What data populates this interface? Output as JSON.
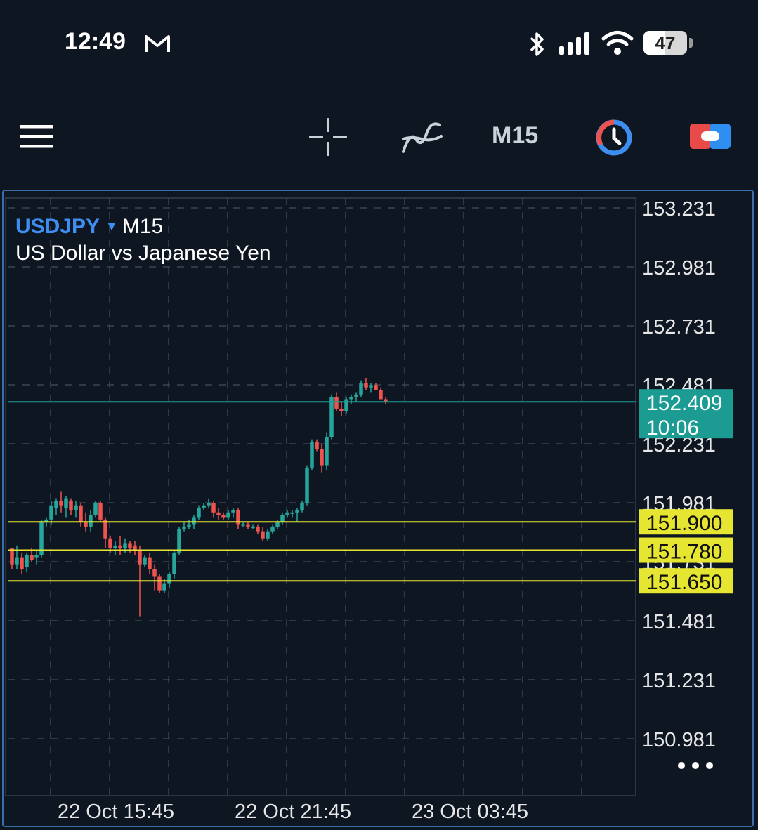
{
  "status_bar": {
    "time": "12:49",
    "battery": "47"
  },
  "toolbar": {
    "timeframe": "M15"
  },
  "chart": {
    "symbol": "USDJPY",
    "timeframe": "M15",
    "description": "US Dollar vs Japanese Yen",
    "current_price": "152.409",
    "countdown": "10:06"
  },
  "colors": {
    "background": "#0e1621",
    "bull": "#26a69a",
    "bear": "#ef5350",
    "level_line": "#e6e632",
    "current_line": "#1c9b93",
    "accent": "#3d8ef0"
  },
  "chart_data": {
    "type": "candlestick",
    "y_ticks": [
      "153.231",
      "152.981",
      "152.731",
      "152.481",
      "152.231",
      "151.981",
      "151.731",
      "151.481",
      "151.231",
      "150.981"
    ],
    "x_labels": [
      "22 Oct 15:45",
      "22 Oct 21:45",
      "23 Oct 03:45"
    ],
    "horizontal_levels": [
      {
        "value": 151.9,
        "label": "151.900"
      },
      {
        "value": 151.78,
        "label": "151.780"
      },
      {
        "value": 151.65,
        "label": "151.650"
      }
    ],
    "current_price": 152.409,
    "candles": [
      [
        151.79,
        151.79,
        151.7,
        151.72
      ],
      [
        151.72,
        151.8,
        151.7,
        151.75
      ],
      [
        151.75,
        151.77,
        151.68,
        151.7
      ],
      [
        151.71,
        151.77,
        151.69,
        151.76
      ],
      [
        151.76,
        151.79,
        151.73,
        151.74
      ],
      [
        151.75,
        151.78,
        151.72,
        151.76
      ],
      [
        151.76,
        151.91,
        151.75,
        151.9
      ],
      [
        151.9,
        151.92,
        151.88,
        151.91
      ],
      [
        151.91,
        151.99,
        151.89,
        151.97
      ],
      [
        151.96,
        152.0,
        151.93,
        151.99
      ],
      [
        151.99,
        152.03,
        151.94,
        151.97
      ],
      [
        151.96,
        152.01,
        151.92,
        152.0
      ],
      [
        151.99,
        152.0,
        151.93,
        151.95
      ],
      [
        151.95,
        151.99,
        151.92,
        151.97
      ],
      [
        151.97,
        151.98,
        151.88,
        151.9
      ],
      [
        151.9,
        151.94,
        151.86,
        151.88
      ],
      [
        151.88,
        151.95,
        151.86,
        151.93
      ],
      [
        151.93,
        151.99,
        151.92,
        151.98
      ],
      [
        151.98,
        151.99,
        151.9,
        151.91
      ],
      [
        151.91,
        151.92,
        151.79,
        151.83
      ],
      [
        151.83,
        151.84,
        151.77,
        151.79
      ],
      [
        151.79,
        151.82,
        151.76,
        151.8
      ],
      [
        151.8,
        151.84,
        151.76,
        151.79
      ],
      [
        151.79,
        151.83,
        151.77,
        151.81
      ],
      [
        151.81,
        151.82,
        151.77,
        151.79
      ],
      [
        151.8,
        151.82,
        151.76,
        151.78
      ],
      [
        151.78,
        151.8,
        151.5,
        151.72
      ],
      [
        151.72,
        151.76,
        151.71,
        151.75
      ],
      [
        151.75,
        151.77,
        151.68,
        151.7
      ],
      [
        151.7,
        151.72,
        151.61,
        151.67
      ],
      [
        151.67,
        151.68,
        151.6,
        151.61
      ],
      [
        151.61,
        151.66,
        151.6,
        151.64
      ],
      [
        151.64,
        151.69,
        151.62,
        151.68
      ],
      [
        151.68,
        151.78,
        151.66,
        151.77
      ],
      [
        151.77,
        151.88,
        151.76,
        151.87
      ],
      [
        151.87,
        151.9,
        151.86,
        151.88
      ],
      [
        151.88,
        151.91,
        151.87,
        151.89
      ],
      [
        151.89,
        151.93,
        151.87,
        151.92
      ],
      [
        151.92,
        151.97,
        151.91,
        151.96
      ],
      [
        151.96,
        151.98,
        151.95,
        151.97
      ],
      [
        151.97,
        152.0,
        151.96,
        151.98
      ],
      [
        151.98,
        151.99,
        151.92,
        151.94
      ],
      [
        151.94,
        151.96,
        151.91,
        151.93
      ],
      [
        151.93,
        151.94,
        151.91,
        151.92
      ],
      [
        151.92,
        151.95,
        151.91,
        151.94
      ],
      [
        151.94,
        151.96,
        151.92,
        151.95
      ],
      [
        151.95,
        151.96,
        151.87,
        151.89
      ],
      [
        151.89,
        151.9,
        151.88,
        151.89
      ],
      [
        151.89,
        151.9,
        151.87,
        151.88
      ],
      [
        151.88,
        151.89,
        151.87,
        151.88
      ],
      [
        151.88,
        151.89,
        151.85,
        151.86
      ],
      [
        151.86,
        151.88,
        151.82,
        151.83
      ],
      [
        151.83,
        151.87,
        151.82,
        151.86
      ],
      [
        151.86,
        151.89,
        151.85,
        151.88
      ],
      [
        151.88,
        151.91,
        151.87,
        151.9
      ],
      [
        151.9,
        151.94,
        151.89,
        151.93
      ],
      [
        151.93,
        151.95,
        151.92,
        151.94
      ],
      [
        151.94,
        151.95,
        151.92,
        151.94
      ],
      [
        151.94,
        151.96,
        151.9,
        151.95
      ],
      [
        151.95,
        151.99,
        151.94,
        151.98
      ],
      [
        151.98,
        152.14,
        151.97,
        152.13
      ],
      [
        152.13,
        152.25,
        152.12,
        152.24
      ],
      [
        152.24,
        152.25,
        152.2,
        152.21
      ],
      [
        152.21,
        152.23,
        152.11,
        152.14
      ],
      [
        152.14,
        152.28,
        152.12,
        152.26
      ],
      [
        152.26,
        152.44,
        152.25,
        152.43
      ],
      [
        152.43,
        152.45,
        152.37,
        152.38
      ],
      [
        152.38,
        152.41,
        152.35,
        152.37
      ],
      [
        152.37,
        152.43,
        152.36,
        152.42
      ],
      [
        152.42,
        152.44,
        152.4,
        152.43
      ],
      [
        152.43,
        152.45,
        152.41,
        152.44
      ],
      [
        152.44,
        152.5,
        152.43,
        152.49
      ],
      [
        152.49,
        152.51,
        152.46,
        152.47
      ],
      [
        152.47,
        152.49,
        152.45,
        152.48
      ],
      [
        152.48,
        152.49,
        152.46,
        152.46
      ],
      [
        152.46,
        152.47,
        152.42,
        152.42
      ],
      [
        152.42,
        152.43,
        152.4,
        152.41
      ]
    ]
  }
}
